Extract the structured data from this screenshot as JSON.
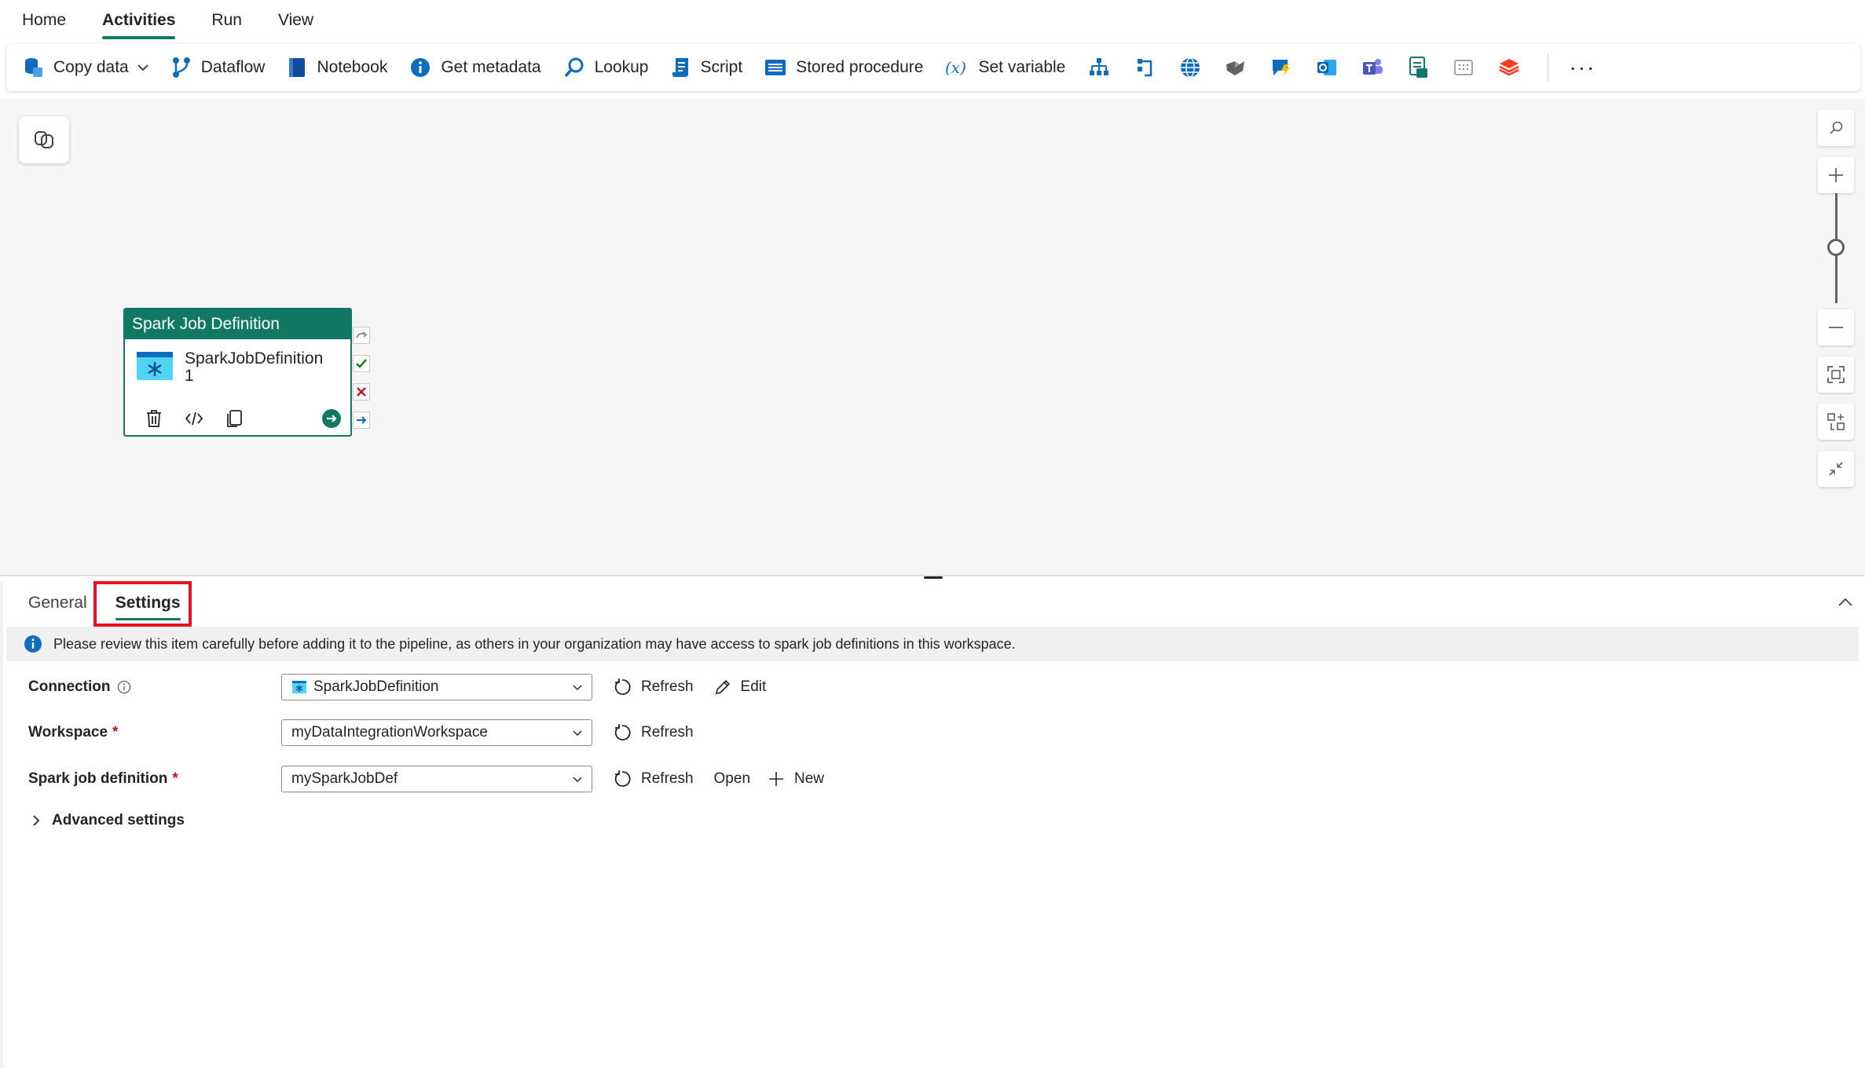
{
  "menu": {
    "tabs": [
      {
        "label": "Home"
      },
      {
        "label": "Activities"
      },
      {
        "label": "Run"
      },
      {
        "label": "View"
      }
    ],
    "active_tab": "Activities"
  },
  "ribbon": {
    "items": [
      {
        "label": "Copy data",
        "icon": "copy-data-icon"
      },
      {
        "label": "Dataflow",
        "icon": "dataflow-icon"
      },
      {
        "label": "Notebook",
        "icon": "notebook-icon"
      },
      {
        "label": "Get metadata",
        "icon": "get-metadata-icon"
      },
      {
        "label": "Lookup",
        "icon": "lookup-icon"
      },
      {
        "label": "Script",
        "icon": "script-icon"
      },
      {
        "label": "Stored procedure",
        "icon": "stored-procedure-icon"
      },
      {
        "label": "Set variable",
        "icon": "set-variable-icon"
      }
    ],
    "icon_only": [
      "switch-icon",
      "filter-icon",
      "web-icon",
      "webhook-icon",
      "azure-function-icon",
      "outlook-icon",
      "teams-icon",
      "kql-icon",
      "semantic-model-icon",
      "databricks-icon"
    ],
    "more": "···"
  },
  "canvas": {
    "activity": {
      "type_label": "Spark Job Definition",
      "name_line1": "SparkJobDefinition",
      "name_line2": "1"
    }
  },
  "panel": {
    "tabs": [
      {
        "label": "General"
      },
      {
        "label": "Settings"
      }
    ],
    "active_tab": "Settings",
    "info_message": "Please review this item carefully before adding it to the pipeline, as others in your organization may have access to spark job definitions in this workspace.",
    "connection": {
      "label": "Connection",
      "value": "SparkJobDefinition",
      "refresh": "Refresh",
      "edit": "Edit"
    },
    "workspace": {
      "label": "Workspace",
      "required": "*",
      "value": "myDataIntegrationWorkspace",
      "refresh": "Refresh"
    },
    "spark_job": {
      "label": "Spark job definition",
      "required": "*",
      "value": "mySparkJobDef",
      "refresh": "Refresh",
      "open": "Open",
      "new": "New"
    },
    "advanced": "Advanced settings"
  },
  "colors": {
    "accent": "#117865",
    "highlight": "#e81123",
    "required": "#c50f1f",
    "info": "#0f6cbd"
  }
}
